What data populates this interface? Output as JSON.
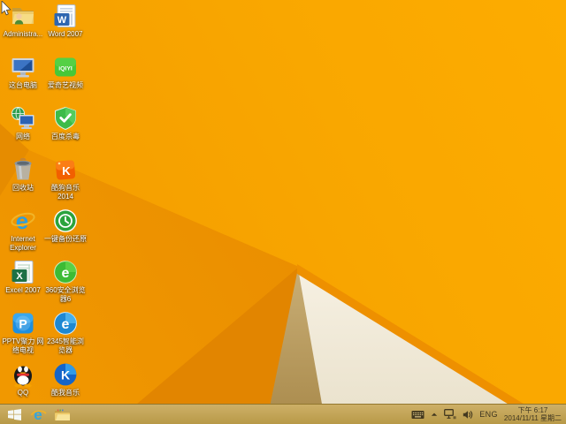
{
  "desktop": {
    "icons": [
      {
        "id": "administrator-folder",
        "label": "Administra..."
      },
      {
        "id": "word-2007",
        "label": "Word 2007"
      },
      {
        "id": "this-pc",
        "label": "这台电脑"
      },
      {
        "id": "iqiyi-video",
        "label": "爱奇艺视频"
      },
      {
        "id": "network",
        "label": "网络"
      },
      {
        "id": "baidu-antivirus",
        "label": "百度杀毒"
      },
      {
        "id": "recycle-bin",
        "label": "回收站"
      },
      {
        "id": "kugou-music-2014",
        "label": "酷狗音乐 2014"
      },
      {
        "id": "internet-explorer",
        "label": "Internet Explorer"
      },
      {
        "id": "onekey-backup-restore",
        "label": "一键备份还原"
      },
      {
        "id": "excel-2007",
        "label": "Excel 2007"
      },
      {
        "id": "360-safe-browser-6",
        "label": "360安全浏览器6"
      },
      {
        "id": "pptv",
        "label": "PPTV聚力 网络电视"
      },
      {
        "id": "2345-smart-browser",
        "label": "2345智能浏览器"
      },
      {
        "id": "qq",
        "label": "QQ"
      },
      {
        "id": "kuwo-music",
        "label": "酷我音乐"
      }
    ]
  },
  "taskbar": {
    "tray": {
      "language": "ENG",
      "time": "下午 6:17",
      "date": "2014/11/11 星期二"
    }
  },
  "wallpaper_colors": {
    "base_left": "#F49D00",
    "base_right": "#FDAC00",
    "left_wedge": "#E68C00",
    "fan": "#F09500",
    "fan_shadow": "#E28500",
    "khaki_top": "#C9AE76",
    "khaki_bottom": "#A98A4B",
    "white_fold_top": "#F6F0E2",
    "white_fold_bottom": "#E9E1CB",
    "fold_strip": "#EE9000",
    "taskbar": "#C2A254"
  }
}
